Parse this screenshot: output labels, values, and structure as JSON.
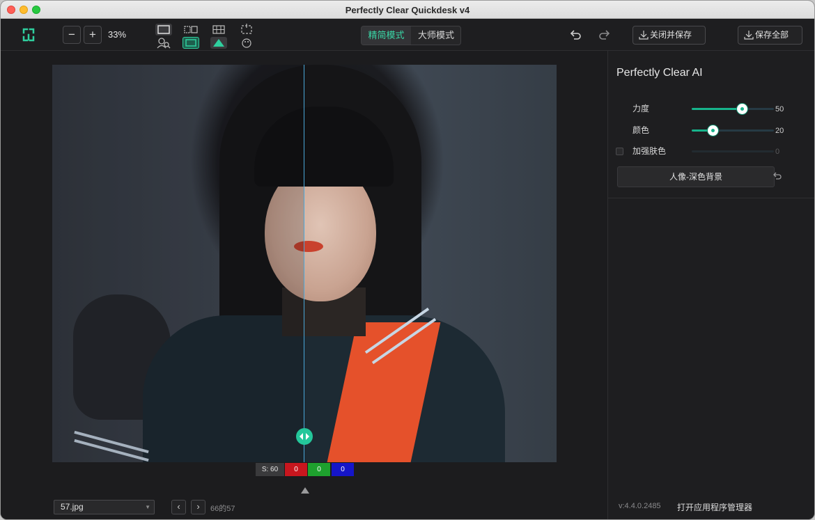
{
  "app": {
    "title": "Perfectly Clear Quickdesk v4"
  },
  "toolbar": {
    "zoom_minus": "−",
    "zoom_plus": "+",
    "zoom_value": "33%",
    "mode_simple": "精简模式",
    "mode_master": "大师模式",
    "save_close_label": "关闭并保存",
    "save_all_label": "保存全部"
  },
  "pixel_readout": {
    "s": "S: 60",
    "r": "0",
    "g": "0",
    "b": "0"
  },
  "footer": {
    "file_name": "57.jpg",
    "prev": "‹",
    "next": "›",
    "counter": "66的57"
  },
  "panel": {
    "title": "Perfectly Clear AI",
    "sliders": [
      {
        "label": "力度",
        "value": "50",
        "fraction": 0.61
      },
      {
        "label": "颜色",
        "value": "20",
        "fraction": 0.25
      },
      {
        "label": "加强肤色",
        "value": "0",
        "fraction": 0.0
      }
    ],
    "preset_label": "人像-深色背景",
    "version": "v:4.4.0.2485",
    "open_manager": "打开应用程序管理器"
  },
  "colors": {
    "accent": "#17b48b",
    "background": "#1c1c1e"
  },
  "icons": [
    "app-logo-icon",
    "single-view-icon",
    "compare-view-icon",
    "grid-view-icon",
    "crop-icon",
    "face-search-icon",
    "frame-icon",
    "triangle-icon",
    "paint-icon",
    "undo-icon",
    "redo-icon",
    "download-icon",
    "reset-icon"
  ]
}
